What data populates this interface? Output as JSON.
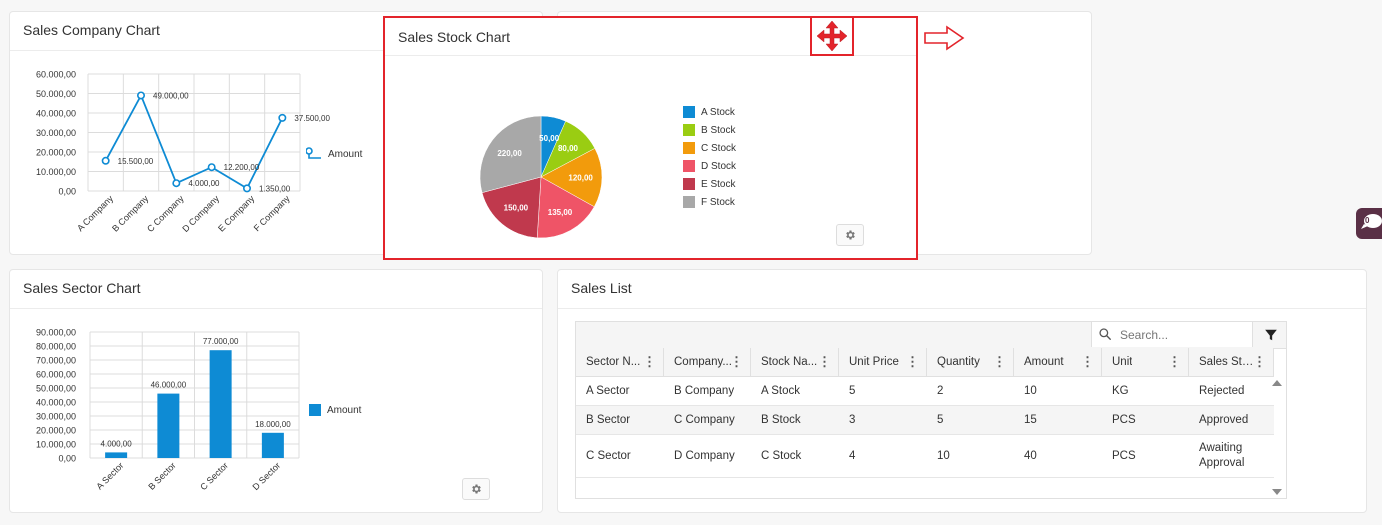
{
  "company_chart": {
    "title": "Sales Company Chart",
    "legend": "Amount",
    "y_ticks": [
      "60.000,00",
      "50.000,00",
      "40.000,00",
      "30.000,00",
      "20.000,00",
      "10.000,00",
      "0,00"
    ],
    "point_labels": [
      "15.500,00",
      "49.000,00",
      "4.000,00",
      "12.200,00",
      "1.350,00",
      "37.500,00"
    ],
    "categories": [
      "A Company",
      "B Company",
      "C Company",
      "D Company",
      "E Company",
      "F Company"
    ]
  },
  "stock_chart": {
    "title": "Sales Stock Chart",
    "slice_labels": [
      "50,00",
      "80,00",
      "120,00",
      "135,00",
      "150,00",
      "220,00"
    ],
    "legend": [
      "A Stock",
      "B Stock",
      "C Stock",
      "D Stock",
      "E Stock",
      "F Stock"
    ],
    "colors": [
      "#0e8bd4",
      "#9acd12",
      "#f29b0c",
      "#ef5467",
      "#c0394d",
      "#a8a8a8"
    ]
  },
  "sector_chart": {
    "title": "Sales Sector Chart",
    "legend": "Amount",
    "y_ticks": [
      "90.000,00",
      "80.000,00",
      "70.000,00",
      "60.000,00",
      "50.000,00",
      "40.000,00",
      "30.000,00",
      "20.000,00",
      "10.000,00",
      "0,00"
    ],
    "bar_labels": [
      "4.000,00",
      "46.000,00",
      "77.000,00",
      "18.000,00"
    ],
    "categories": [
      "A Sector",
      "B Sector",
      "C Sector",
      "D Sector"
    ]
  },
  "sales_list": {
    "title": "Sales List",
    "search_placeholder": "Search...",
    "columns": [
      "Sector Name",
      "Company Name",
      "Stock Name",
      "Unit Price",
      "Quantity",
      "Amount",
      "Unit",
      "Sales Status"
    ],
    "column_display": [
      "Sector N...",
      "Company...",
      "Stock Na...",
      "Unit Price",
      "Quantity",
      "Amount",
      "Unit",
      "Sales Sta..."
    ],
    "rows": [
      [
        "A Sector",
        "B Company",
        "A Stock",
        "5",
        "2",
        "10",
        "KG",
        "Rejected"
      ],
      [
        "B Sector",
        "C Company",
        "B Stock",
        "3",
        "5",
        "15",
        "PCS",
        "Approved"
      ],
      [
        "C Sector",
        "D Company",
        "C Stock",
        "4",
        "10",
        "40",
        "PCS",
        "Awaiting Approval"
      ]
    ]
  },
  "chat": {
    "badge": "0"
  },
  "chart_data": [
    {
      "type": "line",
      "title": "Sales Company Chart",
      "categories": [
        "A Company",
        "B Company",
        "C Company",
        "D Company",
        "E Company",
        "F Company"
      ],
      "series": [
        {
          "name": "Amount",
          "values": [
            15500,
            49000,
            4000,
            12200,
            1350,
            37500
          ]
        }
      ],
      "ylim": [
        0,
        60000
      ],
      "grid": true,
      "legend": "right"
    },
    {
      "type": "pie",
      "title": "Sales Stock Chart",
      "categories": [
        "A Stock",
        "B Stock",
        "C Stock",
        "D Stock",
        "E Stock",
        "F Stock"
      ],
      "values": [
        50,
        80,
        120,
        135,
        150,
        220
      ],
      "legend": "right"
    },
    {
      "type": "bar",
      "title": "Sales Sector Chart",
      "categories": [
        "A Sector",
        "B Sector",
        "C Sector",
        "D Sector"
      ],
      "series": [
        {
          "name": "Amount",
          "values": [
            4000,
            46000,
            77000,
            18000
          ]
        }
      ],
      "ylim": [
        0,
        90000
      ],
      "grid": true,
      "legend": "right"
    }
  ]
}
